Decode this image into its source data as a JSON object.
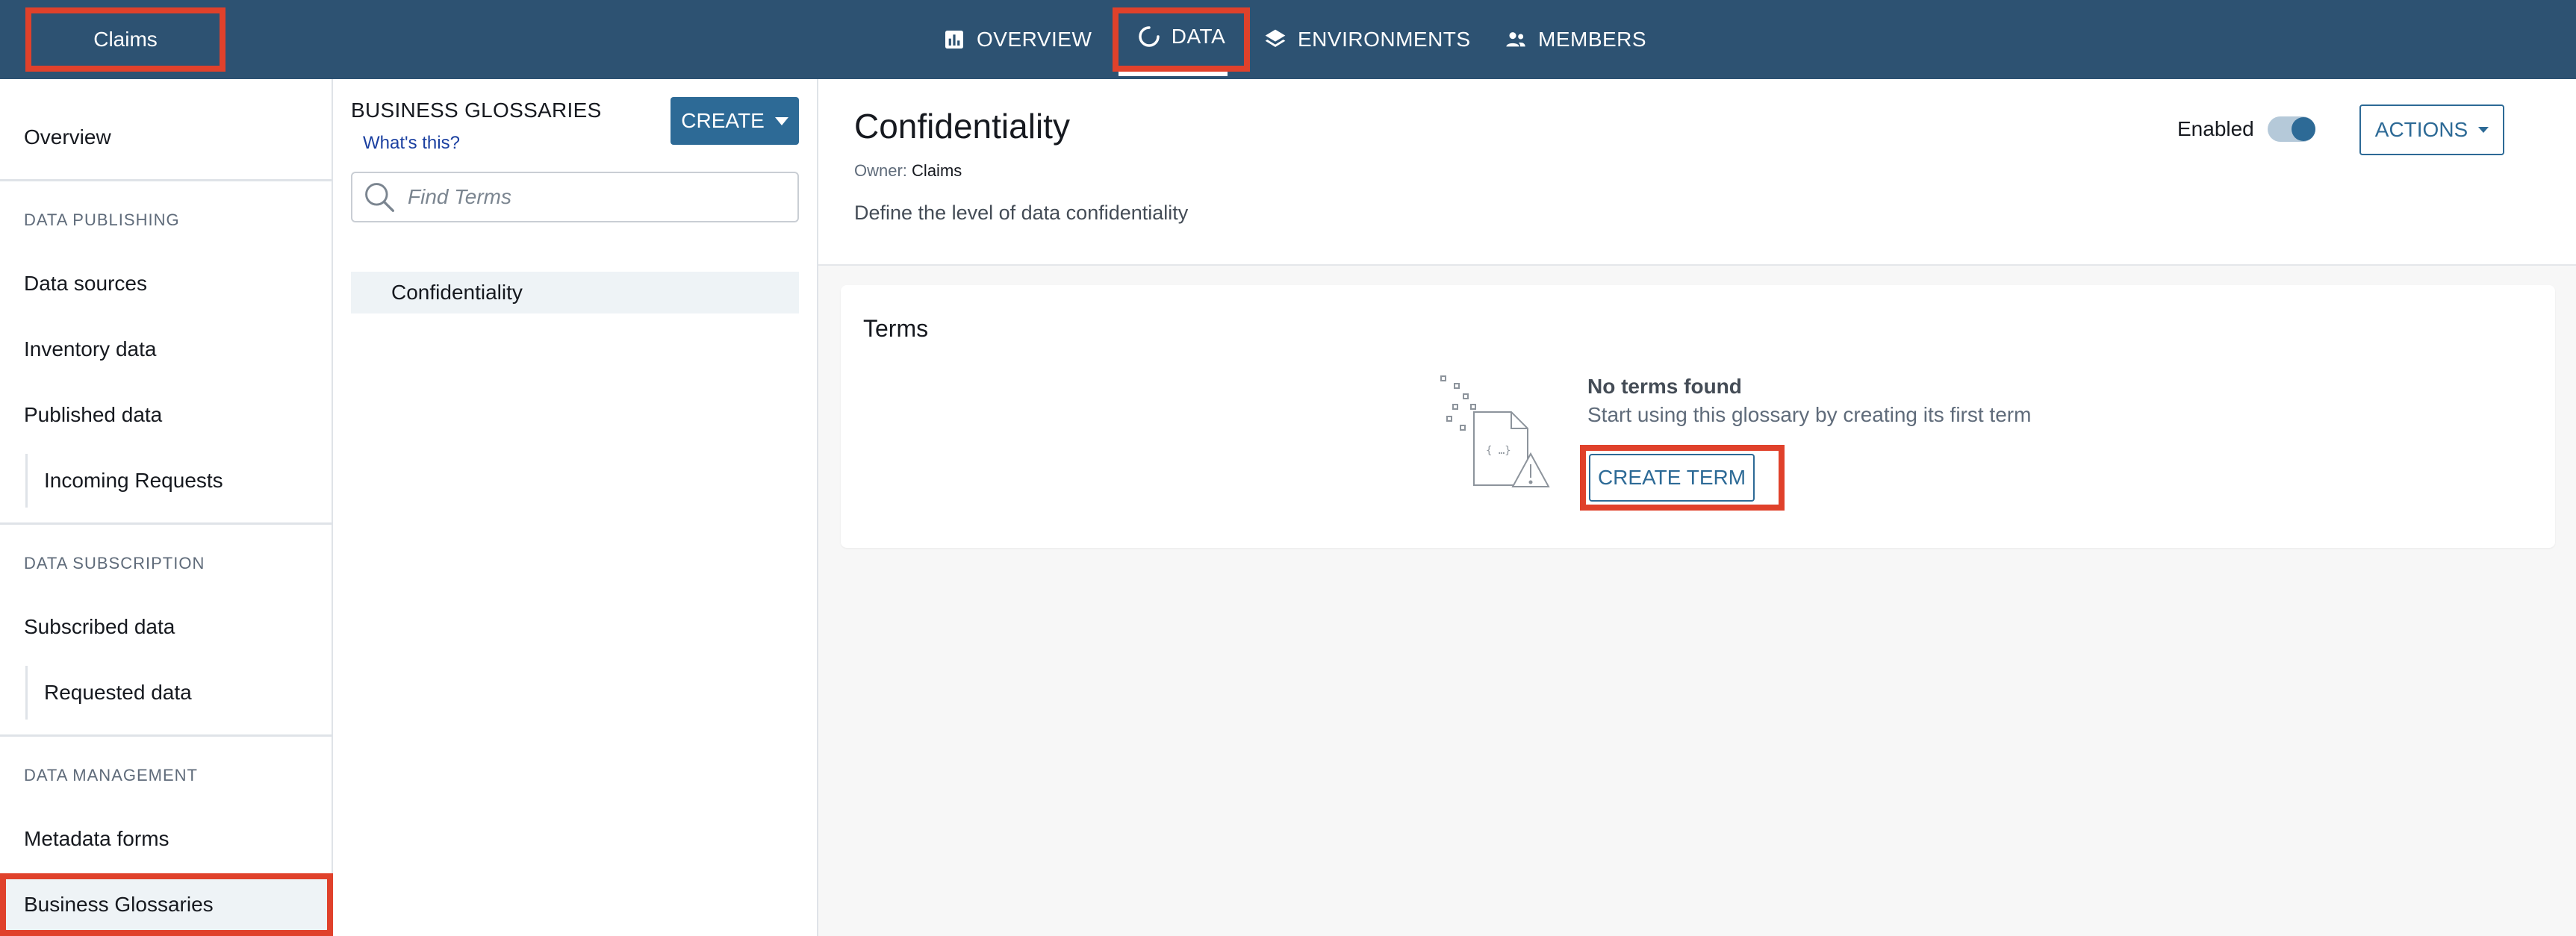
{
  "topbar": {
    "project_name": "Claims",
    "nav": [
      {
        "label": "OVERVIEW",
        "icon": "bar-chart-icon"
      },
      {
        "label": "DATA",
        "icon": "spinner-icon"
      },
      {
        "label": "ENVIRONMENTS",
        "icon": "layers-icon"
      },
      {
        "label": "MEMBERS",
        "icon": "people-icon"
      }
    ]
  },
  "leftnav": {
    "overview": "Overview",
    "sections": [
      {
        "title": "DATA PUBLISHING",
        "items": [
          "Data sources",
          "Inventory data",
          "Published data"
        ],
        "subitems": [
          "Incoming Requests"
        ]
      },
      {
        "title": "DATA SUBSCRIPTION",
        "items": [
          "Subscribed data"
        ],
        "subitems": [
          "Requested data"
        ]
      },
      {
        "title": "DATA MANAGEMENT",
        "items": [
          "Metadata forms",
          "Business Glossaries"
        ]
      }
    ]
  },
  "glossary": {
    "title": "BUSINESS GLOSSARIES",
    "help_link": "What's this?",
    "create_label": "CREATE",
    "search_placeholder": "Find Terms",
    "items": [
      "Confidentiality"
    ]
  },
  "detail": {
    "title": "Confidentiality",
    "owner_label": "Owner:",
    "owner_value": "Claims",
    "description": "Define the level of data confidentiality",
    "enabled_label": "Enabled",
    "enabled": true,
    "actions_label": "ACTIONS"
  },
  "terms": {
    "title": "Terms",
    "empty_title": "No terms found",
    "empty_subtitle": "Start using this glossary by creating its first term",
    "create_label": "CREATE TERM"
  },
  "colors": {
    "topbar": "#2d5272",
    "accent": "#2d6a96",
    "highlight": "#e0412b"
  }
}
